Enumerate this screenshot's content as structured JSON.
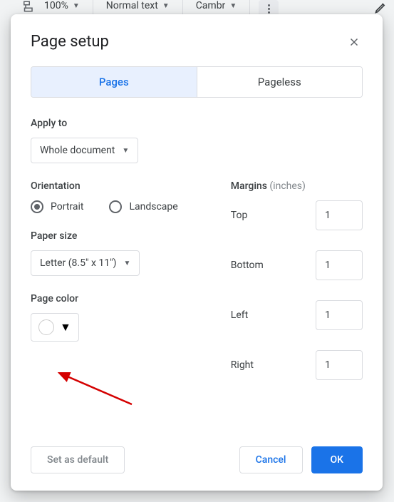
{
  "bg_toolbar": {
    "zoom": "100%",
    "style": "Normal text",
    "font": "Cambr"
  },
  "dialog": {
    "title": "Page setup"
  },
  "tabs": {
    "pages": "Pages",
    "pageless": "Pageless"
  },
  "apply_to": {
    "label": "Apply to",
    "value": "Whole document"
  },
  "orientation": {
    "label": "Orientation",
    "portrait": "Portrait",
    "landscape": "Landscape"
  },
  "paper_size": {
    "label": "Paper size",
    "value": "Letter (8.5\" x 11\")"
  },
  "page_color": {
    "label": "Page color"
  },
  "margins": {
    "label": "Margins",
    "unit": "(inches)",
    "top_label": "Top",
    "top_value": "1",
    "bottom_label": "Bottom",
    "bottom_value": "1",
    "left_label": "Left",
    "left_value": "1",
    "right_label": "Right",
    "right_value": "1"
  },
  "footer": {
    "set_default": "Set as default",
    "cancel": "Cancel",
    "ok": "OK"
  }
}
